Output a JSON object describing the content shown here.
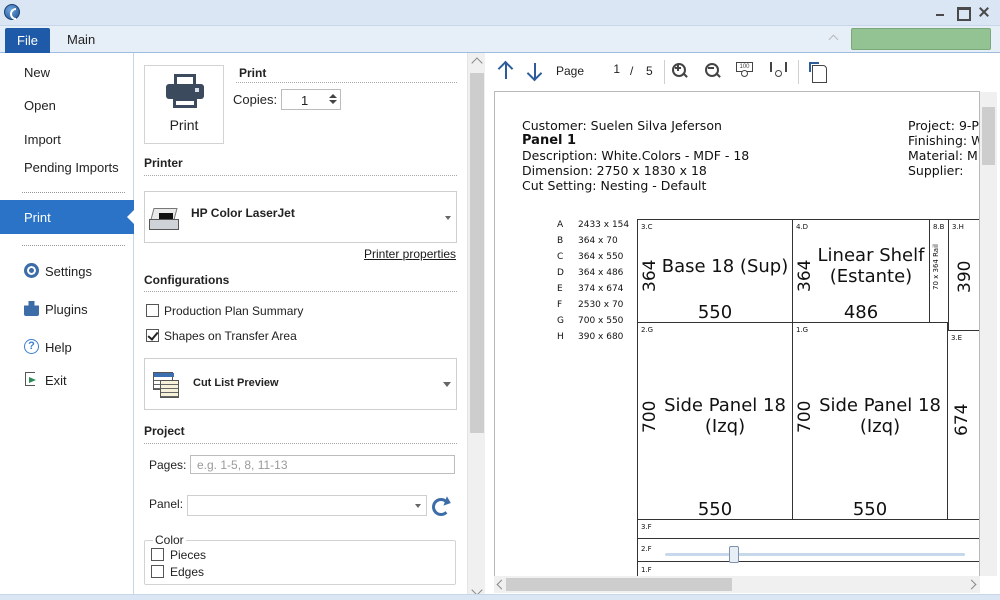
{
  "ribbon": {
    "file_tab": "File",
    "main_tab": "Main"
  },
  "nav": {
    "items": [
      "New",
      "Open",
      "Import",
      "Pending Imports",
      "Print",
      "Settings",
      "Plugins",
      "Help",
      "Exit"
    ],
    "active": "Print"
  },
  "print": {
    "button_label": "Print",
    "section_title": "Print",
    "copies_label": "Copies:",
    "copies_value": "1"
  },
  "printer": {
    "section_title": "Printer",
    "selected": "HP Color LaserJet",
    "properties_link": "Printer properties"
  },
  "configurations": {
    "section_title": "Configurations",
    "options": [
      {
        "label": "Production Plan Summary",
        "checked": false
      },
      {
        "label": "Shapes on Transfer Area",
        "checked": true
      }
    ],
    "report": "Cut List Preview"
  },
  "project": {
    "section_title": "Project",
    "pages_label": "Pages:",
    "pages_placeholder": "e.g. 1-5, 8, 11-13",
    "panel_label": "Panel:",
    "panel_value": "",
    "color_group_title": "Color",
    "color_options": [
      {
        "label": "Pieces",
        "checked": false
      },
      {
        "label": "Edges",
        "checked": false
      }
    ]
  },
  "preview_toolbar": {
    "page_label": "Page",
    "page_current": "1",
    "page_separator": "/",
    "page_total": "5",
    "icons": [
      "arrow-up-icon",
      "arrow-down-icon",
      "zoom-in-icon",
      "zoom-out-icon",
      "zoom-100-icon",
      "zoom-fit-icon",
      "page-setup-icon"
    ]
  },
  "document": {
    "customer": "Customer: Suelen Silva Jeferson",
    "panel_title": "Panel 1",
    "description": "Description: White.Colors - MDF - 18",
    "dimension": "Dimension: 2750 x 1830 x 18",
    "cut_setting": "Cut Setting: Nesting - Default",
    "project": "Project: 9-P",
    "finishing": "Finishing: W",
    "material": "Material: MI",
    "supplier": "Supplier:",
    "legend": [
      {
        "letter": "A",
        "dim": "2433 x 154"
      },
      {
        "letter": "B",
        "dim": "364 x 70"
      },
      {
        "letter": "C",
        "dim": "364 x 550"
      },
      {
        "letter": "D",
        "dim": "364 x 486"
      },
      {
        "letter": "E",
        "dim": "374 x 674"
      },
      {
        "letter": "F",
        "dim": "2530 x 70"
      },
      {
        "letter": "G",
        "dim": "700 x 550"
      },
      {
        "letter": "H",
        "dim": "390 x 680"
      }
    ],
    "pieces": {
      "base": {
        "id": "3.C",
        "name": "Base 18 (Sup)",
        "w": "550",
        "h": "364"
      },
      "linear": {
        "id": "4.D",
        "name_1": "Linear Shelf",
        "name_2": "(Estante)",
        "w": "486",
        "h": "364"
      },
      "small_b": {
        "id": "8.B",
        "name": "70 x 364 Rail"
      },
      "h_piece": {
        "id": "3.H",
        "h": "390"
      },
      "side_left": {
        "id": "2.G",
        "name_1": "Side Panel 18",
        "name_2": "(Izq)",
        "w": "550",
        "h": "700"
      },
      "side_right": {
        "id": "1.G",
        "name_1": "Side Panel 18",
        "name_2": "(Izq)",
        "w": "550",
        "h": "700"
      },
      "e_piece": {
        "id": "3.E",
        "h": "674"
      },
      "strip_f": {
        "id": "3.F"
      },
      "strip_2f": {
        "id": "2.F"
      },
      "strip_1f": {
        "id": "1.F"
      }
    }
  }
}
